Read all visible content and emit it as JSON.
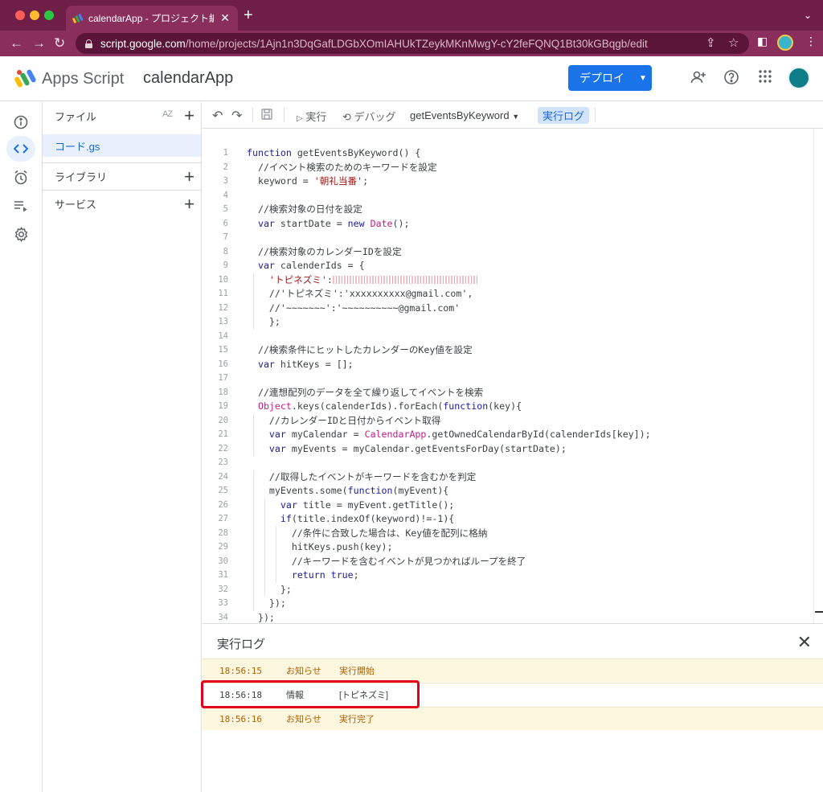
{
  "browser": {
    "tab_title": "calendarApp - プロジェクト編集",
    "url_host": "script.google.com",
    "url_path": "/home/projects/1Ajn1n3DqGafLDGbXOmIAHUkTZeykMKnMwgY-cY2feFQNQ1Bt30kGBqgb/edit"
  },
  "header": {
    "brand": "Apps Script",
    "project_name": "calendarApp",
    "deploy_label": "デプロイ"
  },
  "files": {
    "title": "ファイル",
    "sort_label": "AZ",
    "active_file": "コード.gs",
    "libraries": "ライブラリ",
    "services": "サービス"
  },
  "toolbar": {
    "run": "実行",
    "debug": "デバッグ",
    "function_name": "getEventsByKeyword",
    "log": "実行ログ"
  },
  "code_lines": [
    "function getEventsByKeyword() {",
    "  //イベント検索のためのキーワードを設定",
    "  keyword = '朝礼当番';",
    "",
    "  //検索対象の日付を設定",
    "  var startDate = new Date();",
    "",
    "  //検索対象のカレンダーIDを設定",
    "  var calenderIds = {",
    "    'トピネズミ':",
    "    //'トピネズミ':'xxxxxxxxxx@gmail.com',",
    "    //'~~~~~~~':'~~~~~~~~~~@gmail.com'",
    "    };",
    "",
    "  //検索条件にヒットしたカレンダーのKey値を設定",
    "  var hitKeys = [];",
    "",
    "  //連想配列のデータを全て繰り返してイベントを検索",
    "  Object.keys(calenderIds).forEach(function(key){",
    "    //カレンダーIDと日付からイベント取得",
    "    var myCalendar = CalendarApp.getOwnedCalendarById(calenderIds[key]);",
    "    var myEvents = myCalendar.getEventsForDay(startDate);",
    "",
    "    //取得したイベントがキーワードを含むかを判定",
    "    myEvents.some(function(myEvent){",
    "      var title = myEvent.getTitle();",
    "      if(title.indexOf(keyword)!=-1){",
    "        //条件に合致した場合は、Key値を配列に格納",
    "        hitKeys.push(key);",
    "        //キーワードを含むイベントが見つかればループを終了",
    "        return true;",
    "      };",
    "    });",
    "  });"
  ],
  "log": {
    "title": "実行ログ",
    "rows": [
      {
        "time": "18:56:15",
        "level": "お知らせ",
        "message": "実行開始"
      },
      {
        "time": "18:56:18",
        "level": "情報",
        "message": "[トピネズミ]"
      },
      {
        "time": "18:56:16",
        "level": "お知らせ",
        "message": "実行完了"
      }
    ]
  },
  "colors": {
    "chrome": "#6f1e48",
    "accent": "#1a73e8",
    "notice_bg": "#fef7e0",
    "highlight": "#e4001b"
  }
}
